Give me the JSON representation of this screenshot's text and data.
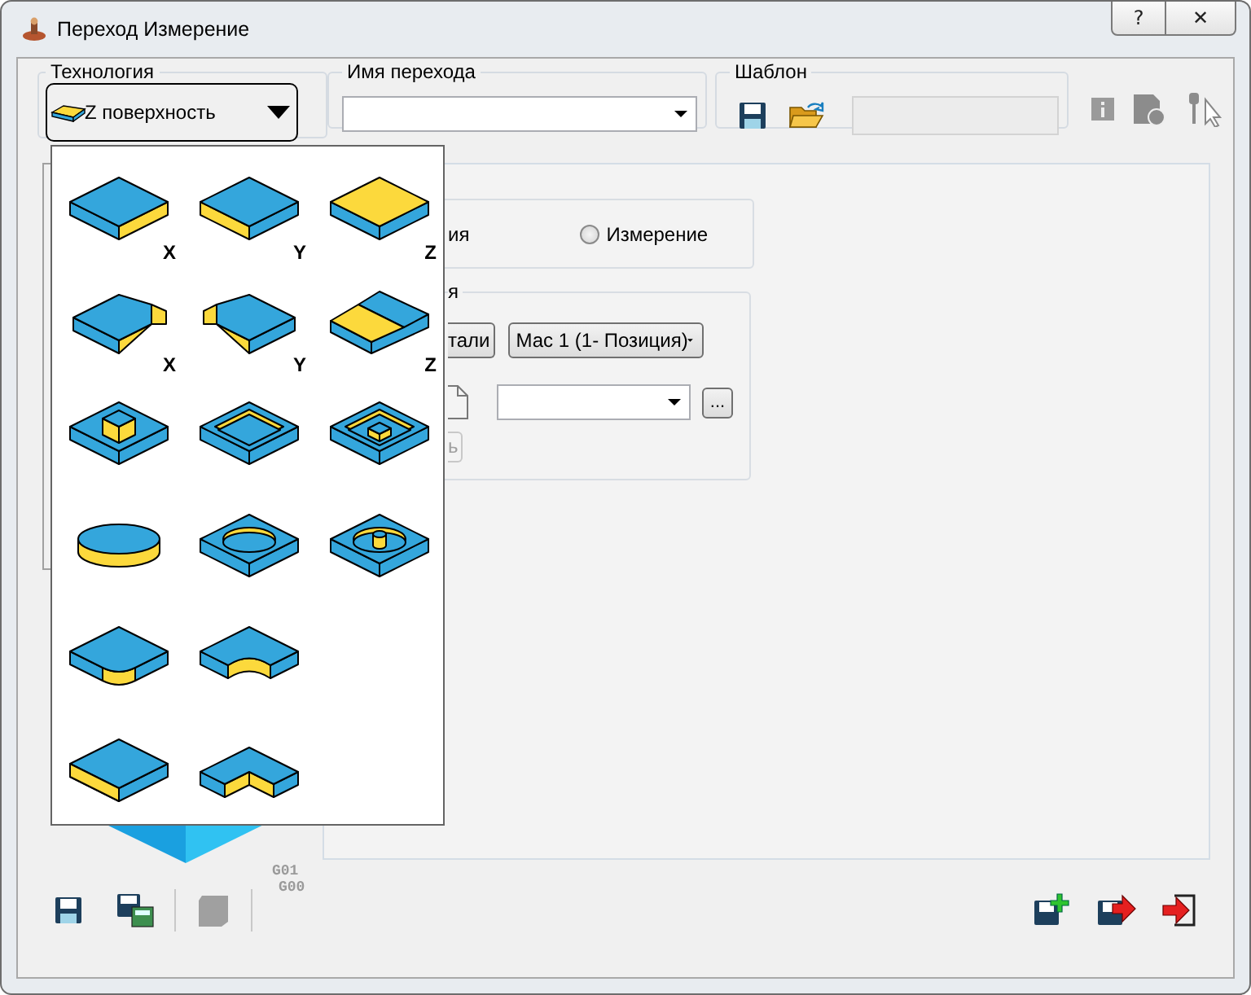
{
  "window": {
    "title": "Переход Измерение",
    "help_button": "?",
    "close_button": "✕"
  },
  "technology": {
    "label": "Технология",
    "value": "Z поверхность"
  },
  "transition_name": {
    "label": "Имя перехода"
  },
  "template": {
    "label": "Шаблон"
  },
  "shape_popup": {
    "items": [
      {
        "kind": "slab-x",
        "axis": "X"
      },
      {
        "kind": "slab-y",
        "axis": "Y"
      },
      {
        "kind": "slab-z",
        "axis": "Z"
      },
      {
        "kind": "chamfer-x",
        "axis": "X"
      },
      {
        "kind": "chamfer-y",
        "axis": "Y"
      },
      {
        "kind": "chamfer-z",
        "axis": "Z"
      },
      {
        "kind": "boss"
      },
      {
        "kind": "pocket"
      },
      {
        "kind": "pocket-boss"
      },
      {
        "kind": "cylinder"
      },
      {
        "kind": "hole"
      },
      {
        "kind": "hole-pin"
      },
      {
        "kind": "fillet"
      },
      {
        "kind": "concave"
      },
      {
        "kind": "empty"
      },
      {
        "kind": "side"
      },
      {
        "kind": "step"
      }
    ]
  },
  "mode_group": {
    "cut_label": "ия",
    "options": [
      {
        "label": "Измерение",
        "selected": false
      }
    ]
  },
  "setup_group": {
    "legend": "я",
    "part_button": "тали",
    "machine": "Мас 1 (1- Позиция)",
    "browse_button": "...",
    "apply_button": "ь"
  },
  "bottom_toolbar": {
    "gcode": [
      "G01",
      "G00"
    ]
  }
}
